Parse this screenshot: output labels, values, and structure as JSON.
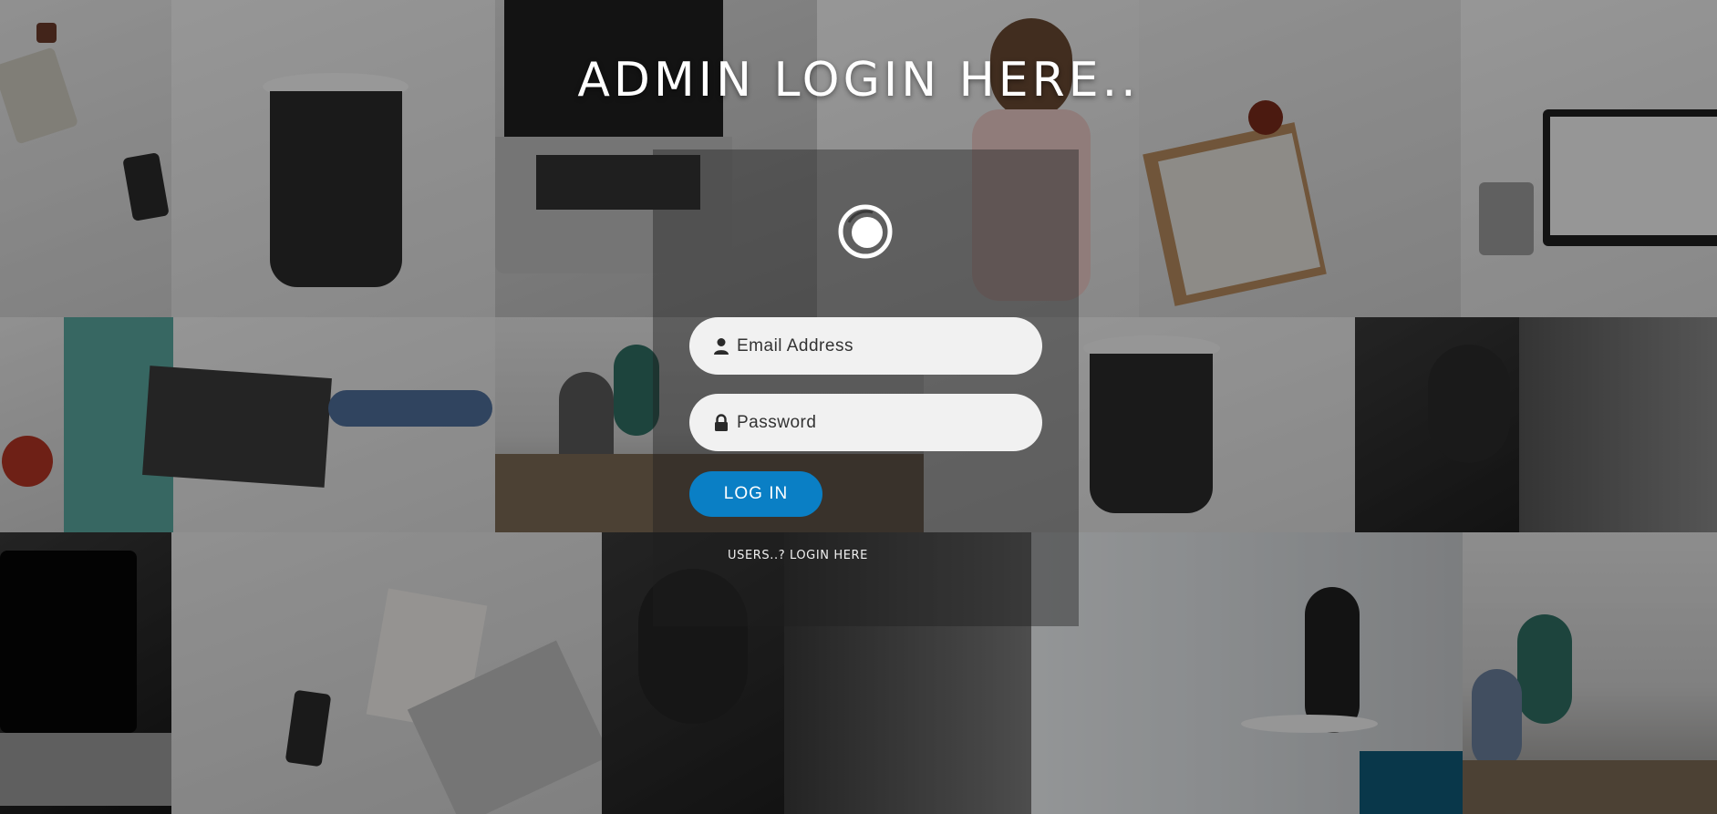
{
  "page": {
    "title": "ADMIN LOGIN HERE.."
  },
  "logo": {
    "icon": "circle-logo-icon"
  },
  "form": {
    "email": {
      "placeholder": "Email Address",
      "value": "",
      "icon": "user-icon"
    },
    "password": {
      "placeholder": "Password",
      "value": "",
      "icon": "lock-icon"
    },
    "submit_label": "LOG IN",
    "user_link_label": "USERS..? LOGIN HERE"
  },
  "colors": {
    "accent": "#0a7fc5",
    "field_bg": "#f1f1f1",
    "title": "#ffffff",
    "panel_overlay": "rgba(30,30,30,0.42)"
  }
}
